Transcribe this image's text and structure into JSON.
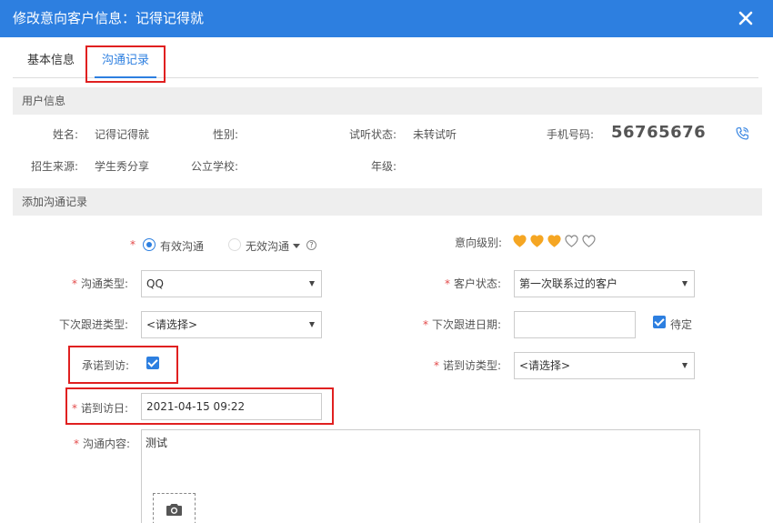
{
  "dialog": {
    "title": "修改意向客户信息：记得记得就",
    "close_icon": "close-icon"
  },
  "tabs": [
    {
      "label": "基本信息",
      "active": false
    },
    {
      "label": "沟通记录",
      "active": true
    }
  ],
  "user_info": {
    "section_title": "用户信息",
    "name_label": "姓名:",
    "name_value": "记得记得就",
    "gender_label": "性别:",
    "gender_value": "",
    "trial_label": "试听状态:",
    "trial_value": "未转试听",
    "phone_label": "手机号码:",
    "phone_value": "56765676",
    "source_label": "招生来源:",
    "source_value": "学生秀分享",
    "school_label": "公立学校:",
    "school_value": "",
    "grade_label": "年级:",
    "grade_value": ""
  },
  "add_record": {
    "section_title": "添加沟通记录",
    "required_mark": "*",
    "valid_comm_label": "有效沟通",
    "invalid_comm_label": "无效沟通",
    "help_glyph": "?",
    "intent_level_label": "意向级别:",
    "intent_level_filled": 3,
    "intent_level_max": 5,
    "comm_type_label": "沟通类型:",
    "comm_type_value": "QQ",
    "customer_status_label": "客户状态:",
    "customer_status_value": "第一次联系过的客户",
    "next_follow_type_label": "下次跟进类型:",
    "next_follow_type_value": "<请选择>",
    "next_follow_date_label": "下次跟进日期:",
    "next_follow_date_value": "",
    "pending_label": "待定",
    "promise_visit_label": "承诺到访:",
    "promise_visit_type_label": "诺到访类型:",
    "promise_visit_type_value": "<请选择>",
    "promise_visit_date_label": "诺到访日:",
    "promise_visit_date_value": "2021-04-15 09:22",
    "content_label": "沟通内容:",
    "content_value": "测试"
  },
  "colors": {
    "accent": "#2d7fe0",
    "heart": "#f5a623",
    "highlight": "#e02020"
  }
}
